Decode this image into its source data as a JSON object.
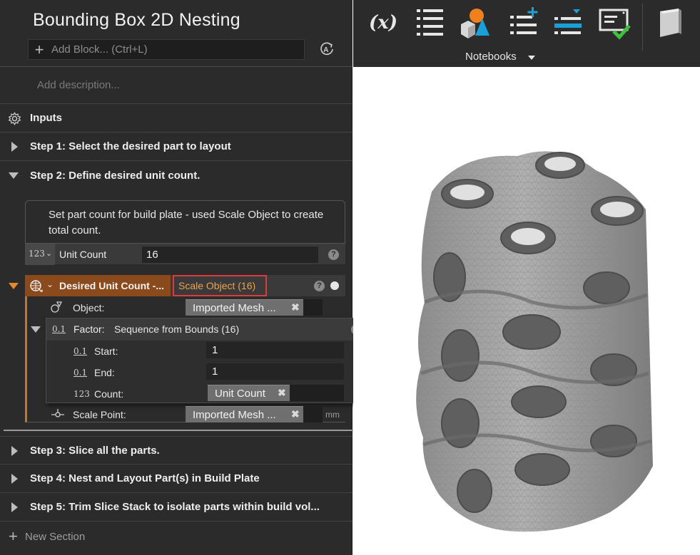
{
  "header": {
    "title": "Bounding Box 2D Nesting",
    "add_block_placeholder": "Add Block... (Ctrl+L)",
    "description_placeholder": "Add description..."
  },
  "sections": {
    "inputs": "Inputs",
    "step1": "Step 1: Select the desired part to layout",
    "step2": "Step 2: Define desired unit count.",
    "step3": "Step 3: Slice all the parts.",
    "step4": "Step 4: Nest and Layout Part(s) in Build Plate",
    "step5": "Step 5: Trim Slice Stack to isolate parts within build vol...",
    "new_section": "New Section"
  },
  "step2": {
    "note": "Set part count for build plate - used Scale Object to create total count.",
    "unit_count": {
      "type_icon": "123",
      "label": "Unit Count",
      "value": "16"
    },
    "desired_unit": {
      "label": "Desired Unit Count -...",
      "operation": "Scale Object (16)",
      "object_label": "Object:",
      "object_value": "Imported Mesh ...",
      "factor_label": "Factor:",
      "factor_value": "Sequence from Bounds (16)",
      "start_label": "Start:",
      "start_value": "1",
      "end_label": "End:",
      "end_value": "1",
      "count_label": "Count:",
      "count_value": "Unit Count",
      "scale_point_label": "Scale Point:",
      "scale_point_value": "Imported Mesh ...",
      "unit": "mm",
      "num_icon": "0.1",
      "int_icon": "123"
    }
  },
  "toolbar": {
    "variables_icon": "(x)",
    "notebooks_label": "Notebooks"
  },
  "colors": {
    "panel_bg": "#2b2b2b",
    "accent_orange": "#c8732a",
    "highlight_red": "#e03a3a",
    "operation_text": "#f1a04a"
  }
}
